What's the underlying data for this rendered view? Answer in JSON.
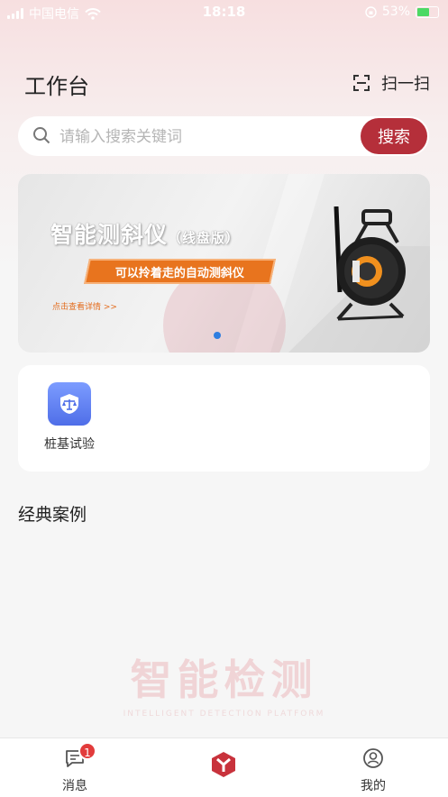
{
  "status_bar": {
    "carrier": "中国电信",
    "time": "18:18",
    "battery": "53%"
  },
  "header": {
    "title": "工作台",
    "scan_label": "扫一扫"
  },
  "search": {
    "placeholder": "请输入搜索关键词",
    "value": "",
    "button_label": "搜索"
  },
  "banner": {
    "title": "智能测斜仪",
    "title_suffix": "（线盘版）",
    "tagline": "可以拎着走的自动测斜仪",
    "link": "点击查看详情 >>"
  },
  "functions": [
    {
      "label": "桩基试验",
      "icon": "scale-shield-icon"
    }
  ],
  "section_title": "经典案例",
  "watermark": {
    "text": "智能检测",
    "subtext": "INTELLIGENT DETECTION PLATFORM"
  },
  "tabbar": {
    "items": [
      {
        "label": "消息",
        "icon": "message-icon",
        "badge": "1"
      },
      {
        "label": "",
        "icon": "home-logo-icon"
      },
      {
        "label": "我的",
        "icon": "user-icon"
      }
    ]
  },
  "colors": {
    "brand": "#b52f3a",
    "accent_blue": "#4f6ee8",
    "banner_orange": "#e8741e"
  }
}
